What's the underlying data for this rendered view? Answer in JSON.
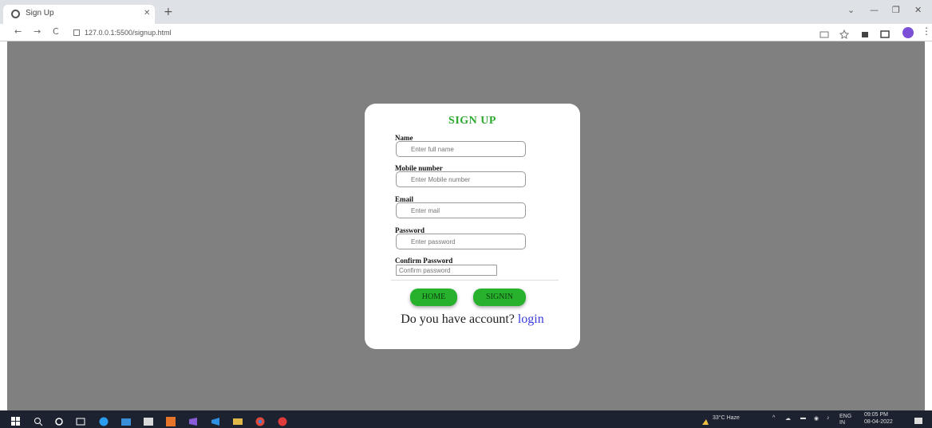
{
  "browser": {
    "tab_title": "Sign Up",
    "tab_close": "×",
    "new_tab": "+",
    "url": "127.0.0.1:5500/signup.html",
    "controls": {
      "back": "←",
      "forward": "→",
      "reload": "C",
      "minimize": "—",
      "restore": "❐",
      "close": "✕",
      "menu": "⋮"
    }
  },
  "form": {
    "title": "SIGN UP",
    "fields": [
      {
        "label": "Name",
        "placeholder": "Enter full name"
      },
      {
        "label": "Mobile number",
        "placeholder": "Enter Mobile number"
      },
      {
        "label": "Email",
        "placeholder": "Enter mail"
      },
      {
        "label": "Password",
        "placeholder": "Enter password"
      },
      {
        "label": "Confirm Password",
        "placeholder": "Confirm password"
      }
    ],
    "home_button": "HOME",
    "signin_button": "SIGNIN",
    "prompt": "Do you have account?",
    "login_link": "login"
  },
  "taskbar": {
    "weather": "33°C Haze",
    "language": "ENG IN",
    "time": "09:05 PM",
    "date": "08-04-2022"
  },
  "colors": {
    "page_background": "#808080",
    "accent_green": "#27b12c",
    "title_green": "#2ea82e",
    "link_blue": "#3a3adf"
  }
}
